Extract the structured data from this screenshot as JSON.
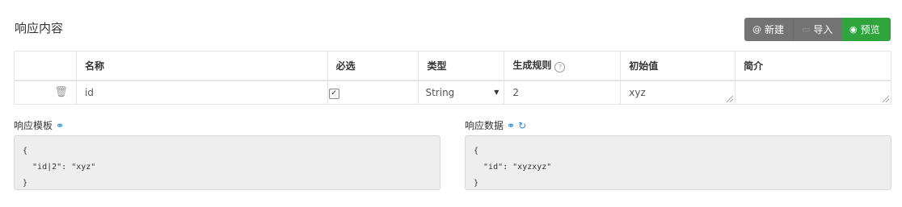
{
  "section_title": "响应内容",
  "toolbar": {
    "new_label": "新建",
    "new_icon": "@",
    "import_label": "导入",
    "preview_label": "预览",
    "accent_green": "#2fa43d",
    "button_gray": "#737373"
  },
  "table": {
    "headers": [
      "名称",
      "必选",
      "类型",
      "生成规则",
      "初始值",
      "简介"
    ],
    "rows": [
      {
        "name": "id",
        "required": true,
        "type": "String",
        "rule": "2",
        "initial": "xyz",
        "description": ""
      }
    ]
  },
  "template_panel": {
    "label": "响应模板",
    "lines": [
      "{",
      "  \"id|2\": \"xyz\"",
      "}"
    ]
  },
  "data_panel": {
    "label": "响应数据",
    "lines": [
      "{",
      "  \"id\": \"xyzxyz\"",
      "}"
    ]
  }
}
